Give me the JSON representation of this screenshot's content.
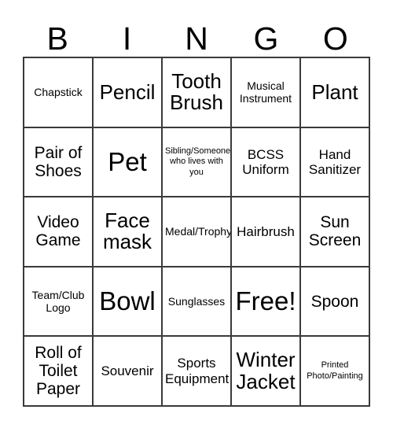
{
  "card": {
    "title": "BINGO",
    "header_letters": [
      "B",
      "I",
      "N",
      "G",
      "O"
    ],
    "border_color": "#3a3a3a",
    "text_color": "#000000",
    "background_color": "#ffffff",
    "rows": 5,
    "columns": 5,
    "cells": [
      [
        {
          "label": "Chapstick",
          "size": "s"
        },
        {
          "label": "Pencil",
          "size": "xl"
        },
        {
          "label": "Tooth\nBrush",
          "size": "xl"
        },
        {
          "label": "Musical\nInstrument",
          "size": "s"
        },
        {
          "label": "Plant",
          "size": "xl"
        }
      ],
      [
        {
          "label": "Pair of\nShoes",
          "size": "l"
        },
        {
          "label": "Pet",
          "size": "xxl"
        },
        {
          "label": "Sibling/Someone\nwho lives with\nyou",
          "size": "xs"
        },
        {
          "label": "BCSS\nUniform",
          "size": "m"
        },
        {
          "label": "Hand\nSanitizer",
          "size": "m"
        }
      ],
      [
        {
          "label": "Video\nGame",
          "size": "l"
        },
        {
          "label": "Face\nmask",
          "size": "xl"
        },
        {
          "label": "Medal/Trophy",
          "size": "s"
        },
        {
          "label": "Hairbrush",
          "size": "m"
        },
        {
          "label": "Sun\nScreen",
          "size": "l"
        }
      ],
      [
        {
          "label": "Team/Club\nLogo",
          "size": "s"
        },
        {
          "label": "Bowl",
          "size": "xxl"
        },
        {
          "label": "Sunglasses",
          "size": "s"
        },
        {
          "label": "Free!",
          "size": "xxl"
        },
        {
          "label": "Spoon",
          "size": "l"
        }
      ],
      [
        {
          "label": "Roll of\nToilet\nPaper",
          "size": "l"
        },
        {
          "label": "Souvenir",
          "size": "m"
        },
        {
          "label": "Sports\nEquipment",
          "size": "m"
        },
        {
          "label": "Winter\nJacket",
          "size": "xl"
        },
        {
          "label": "Printed\nPhoto/Painting",
          "size": "xs"
        }
      ]
    ]
  }
}
